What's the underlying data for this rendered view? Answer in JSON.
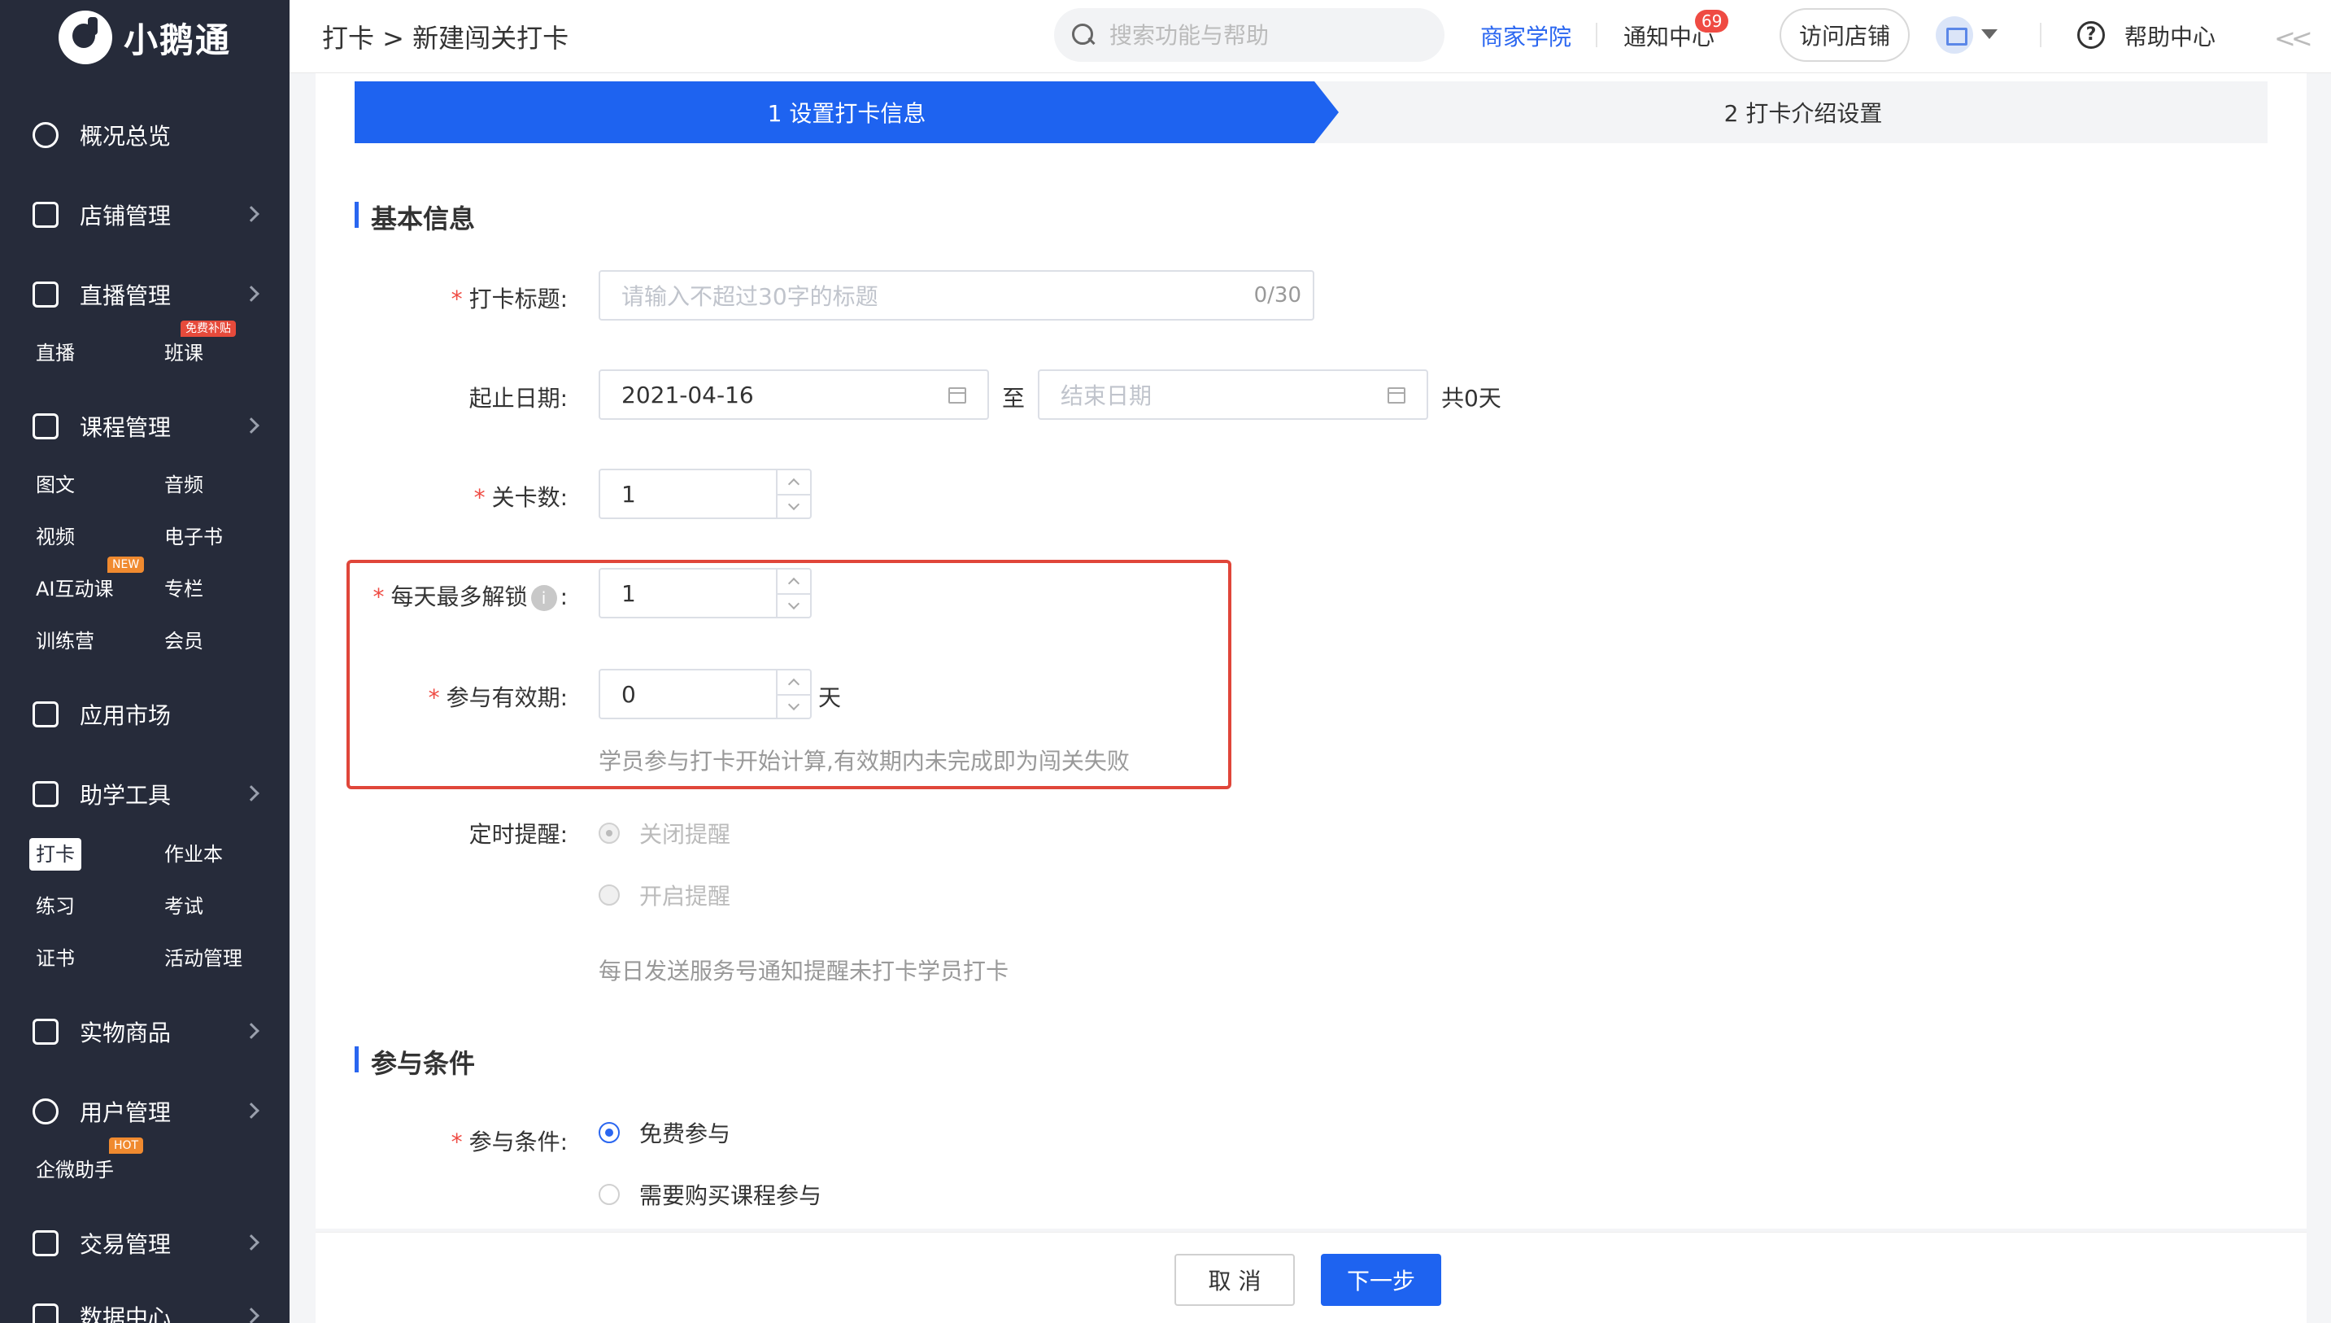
{
  "logo": {
    "text": "小鹅通"
  },
  "sidebar": {
    "items": [
      {
        "label": "概况总览"
      },
      {
        "label": "店铺管理"
      },
      {
        "label": "直播管理"
      },
      {
        "label": "课程管理"
      },
      {
        "label": "应用市场"
      },
      {
        "label": "助学工具"
      },
      {
        "label": "实物商品"
      },
      {
        "label": "用户管理"
      },
      {
        "label": "交易管理"
      },
      {
        "label": "数据中心"
      }
    ],
    "live_subs": [
      "直播",
      "班课"
    ],
    "live_tag": "免费补贴",
    "course_subs": [
      "图文",
      "音频",
      "视频",
      "电子书",
      "AI互动课",
      "专栏",
      "训练营",
      "会员"
    ],
    "course_tag": "NEW",
    "tool_subs": [
      "打卡",
      "作业本",
      "练习",
      "考试",
      "证书",
      "活动管理"
    ],
    "user_subs": [
      "企微助手"
    ],
    "user_tag": "HOT"
  },
  "header": {
    "breadcrumb": "打卡 > 新建闯关打卡",
    "search_placeholder": "搜索功能与帮助",
    "academy": "商家学院",
    "notice": "通知中心",
    "notice_count": "69",
    "visit_store": "访问店铺",
    "help": "帮助中心"
  },
  "steps": {
    "step1": "1 设置打卡信息",
    "step2": "2 打卡介绍设置"
  },
  "basic": {
    "section_title": "基本信息",
    "title_label": "打卡标题:",
    "title_placeholder": "请输入不超过30字的标题",
    "title_count": "0/30",
    "date_label": "起止日期:",
    "start_date": "2021-04-16",
    "date_to": "至",
    "end_placeholder": "结束日期",
    "total_days": "共0天",
    "levels_label": "关卡数:",
    "levels_value": "1",
    "daily_unlock_label": "每天最多解锁",
    "daily_unlock_colon": ":",
    "daily_unlock_value": "1",
    "validity_label": "参与有效期:",
    "validity_value": "0",
    "validity_unit": "天",
    "validity_hint": "学员参与打卡开始计算,有效期内未完成即为闯关失败",
    "reminder_label": "定时提醒:",
    "reminder_off": "关闭提醒",
    "reminder_on": "开启提醒",
    "reminder_hint": "每日发送服务号通知提醒未打卡学员打卡"
  },
  "conditions": {
    "section_title": "参与条件",
    "label": "参与条件:",
    "free": "免费参与",
    "paid": "需要购买课程参与"
  },
  "footer": {
    "cancel": "取 消",
    "next": "下一步"
  },
  "colors": {
    "primary": "#1e63f0",
    "sidebar_bg": "#262b3a",
    "highlight": "#e0463a",
    "required": "#ef4b43"
  }
}
